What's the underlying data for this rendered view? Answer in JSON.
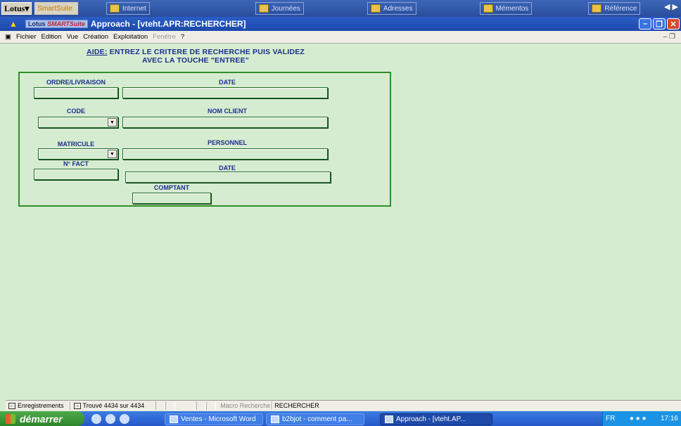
{
  "suite_bar": {
    "lotus": "Lotus",
    "smartsuite": "SmartSuite",
    "tabs": [
      "Internet",
      "Journées",
      "Adresses",
      "Mémentos",
      "Référence"
    ]
  },
  "titlebar": {
    "logo_lotus": "Lotus",
    "logo_smart": "SMART",
    "logo_suite": "Suite",
    "title": "Approach - [vteht.APR:RECHERCHER]"
  },
  "menu": {
    "items": [
      "Fichier",
      "Edition",
      "Vue",
      "Création",
      "Exploitation",
      "Fenêtre",
      "?"
    ]
  },
  "form": {
    "help_label": "AIDE:",
    "help_line1": " ENTREZ LE CRITERE DE RECHERCHE PUIS VALIDEZ",
    "help_line2": "AVEC LA TOUCHE \"ENTREE\"",
    "labels": {
      "ordre": "ORDRE/LIVRAISON",
      "date1": "DATE",
      "code": "CODE",
      "nom": "NOM CLIENT",
      "matricule": "MATRICULE",
      "personnel": "PERSONNEL",
      "nfact": "N° FACT",
      "date2": "DATE",
      "comptant": "COMPTANT"
    }
  },
  "statusbar": {
    "records": "Enregistrements",
    "found": "Trouvé 4434 sur 4434",
    "macro_label": "Macro Recherche",
    "macro_value": "RECHERCHER"
  },
  "taskbar": {
    "start": "démarrer",
    "buttons": [
      "Ventes - Microsoft Word",
      "b2bjot - comment pa...",
      "Approach - [vteht.AP..."
    ],
    "lang": "FR",
    "time": "17:16"
  }
}
